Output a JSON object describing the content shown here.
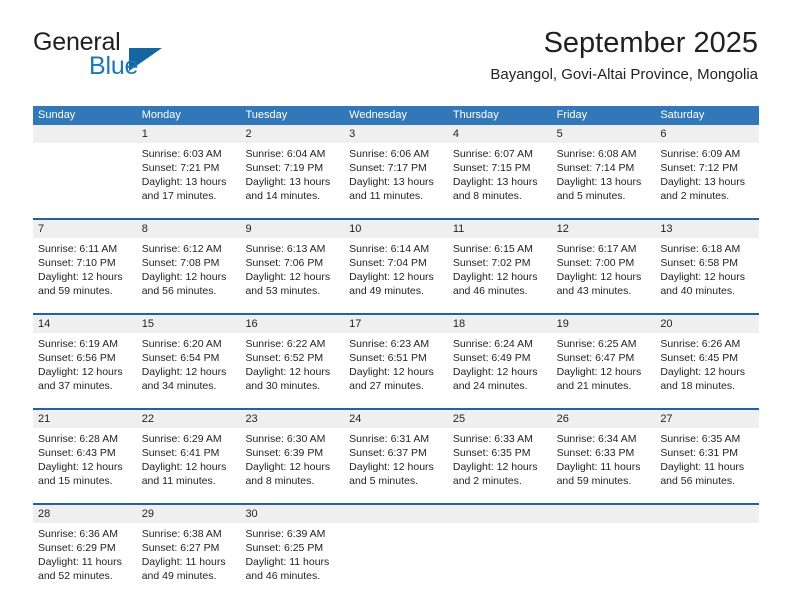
{
  "brand": {
    "name_part1": "General",
    "name_part2": "Blue"
  },
  "header": {
    "title": "September 2025",
    "subtitle": "Bayangol, Govi-Altai Province, Mongolia"
  },
  "colors": {
    "header_blue": "#3278b8",
    "row_border_blue": "#1f63a5",
    "day_band_gray": "#efefef",
    "brand_blue": "#1b77bd",
    "text": "#231f20"
  },
  "weekdays": [
    "Sunday",
    "Monday",
    "Tuesday",
    "Wednesday",
    "Thursday",
    "Friday",
    "Saturday"
  ],
  "weeks": [
    [
      {
        "day": "",
        "empty": true,
        "sunrise": "",
        "sunset": "",
        "daylight_line1": "",
        "daylight_line2": ""
      },
      {
        "day": "1",
        "empty": false,
        "sunrise": "Sunrise: 6:03 AM",
        "sunset": "Sunset: 7:21 PM",
        "daylight_line1": "Daylight: 13 hours",
        "daylight_line2": "and 17 minutes."
      },
      {
        "day": "2",
        "empty": false,
        "sunrise": "Sunrise: 6:04 AM",
        "sunset": "Sunset: 7:19 PM",
        "daylight_line1": "Daylight: 13 hours",
        "daylight_line2": "and 14 minutes."
      },
      {
        "day": "3",
        "empty": false,
        "sunrise": "Sunrise: 6:06 AM",
        "sunset": "Sunset: 7:17 PM",
        "daylight_line1": "Daylight: 13 hours",
        "daylight_line2": "and 11 minutes."
      },
      {
        "day": "4",
        "empty": false,
        "sunrise": "Sunrise: 6:07 AM",
        "sunset": "Sunset: 7:15 PM",
        "daylight_line1": "Daylight: 13 hours",
        "daylight_line2": "and 8 minutes."
      },
      {
        "day": "5",
        "empty": false,
        "sunrise": "Sunrise: 6:08 AM",
        "sunset": "Sunset: 7:14 PM",
        "daylight_line1": "Daylight: 13 hours",
        "daylight_line2": "and 5 minutes."
      },
      {
        "day": "6",
        "empty": false,
        "sunrise": "Sunrise: 6:09 AM",
        "sunset": "Sunset: 7:12 PM",
        "daylight_line1": "Daylight: 13 hours",
        "daylight_line2": "and 2 minutes."
      }
    ],
    [
      {
        "day": "7",
        "empty": false,
        "sunrise": "Sunrise: 6:11 AM",
        "sunset": "Sunset: 7:10 PM",
        "daylight_line1": "Daylight: 12 hours",
        "daylight_line2": "and 59 minutes."
      },
      {
        "day": "8",
        "empty": false,
        "sunrise": "Sunrise: 6:12 AM",
        "sunset": "Sunset: 7:08 PM",
        "daylight_line1": "Daylight: 12 hours",
        "daylight_line2": "and 56 minutes."
      },
      {
        "day": "9",
        "empty": false,
        "sunrise": "Sunrise: 6:13 AM",
        "sunset": "Sunset: 7:06 PM",
        "daylight_line1": "Daylight: 12 hours",
        "daylight_line2": "and 53 minutes."
      },
      {
        "day": "10",
        "empty": false,
        "sunrise": "Sunrise: 6:14 AM",
        "sunset": "Sunset: 7:04 PM",
        "daylight_line1": "Daylight: 12 hours",
        "daylight_line2": "and 49 minutes."
      },
      {
        "day": "11",
        "empty": false,
        "sunrise": "Sunrise: 6:15 AM",
        "sunset": "Sunset: 7:02 PM",
        "daylight_line1": "Daylight: 12 hours",
        "daylight_line2": "and 46 minutes."
      },
      {
        "day": "12",
        "empty": false,
        "sunrise": "Sunrise: 6:17 AM",
        "sunset": "Sunset: 7:00 PM",
        "daylight_line1": "Daylight: 12 hours",
        "daylight_line2": "and 43 minutes."
      },
      {
        "day": "13",
        "empty": false,
        "sunrise": "Sunrise: 6:18 AM",
        "sunset": "Sunset: 6:58 PM",
        "daylight_line1": "Daylight: 12 hours",
        "daylight_line2": "and 40 minutes."
      }
    ],
    [
      {
        "day": "14",
        "empty": false,
        "sunrise": "Sunrise: 6:19 AM",
        "sunset": "Sunset: 6:56 PM",
        "daylight_line1": "Daylight: 12 hours",
        "daylight_line2": "and 37 minutes."
      },
      {
        "day": "15",
        "empty": false,
        "sunrise": "Sunrise: 6:20 AM",
        "sunset": "Sunset: 6:54 PM",
        "daylight_line1": "Daylight: 12 hours",
        "daylight_line2": "and 34 minutes."
      },
      {
        "day": "16",
        "empty": false,
        "sunrise": "Sunrise: 6:22 AM",
        "sunset": "Sunset: 6:52 PM",
        "daylight_line1": "Daylight: 12 hours",
        "daylight_line2": "and 30 minutes."
      },
      {
        "day": "17",
        "empty": false,
        "sunrise": "Sunrise: 6:23 AM",
        "sunset": "Sunset: 6:51 PM",
        "daylight_line1": "Daylight: 12 hours",
        "daylight_line2": "and 27 minutes."
      },
      {
        "day": "18",
        "empty": false,
        "sunrise": "Sunrise: 6:24 AM",
        "sunset": "Sunset: 6:49 PM",
        "daylight_line1": "Daylight: 12 hours",
        "daylight_line2": "and 24 minutes."
      },
      {
        "day": "19",
        "empty": false,
        "sunrise": "Sunrise: 6:25 AM",
        "sunset": "Sunset: 6:47 PM",
        "daylight_line1": "Daylight: 12 hours",
        "daylight_line2": "and 21 minutes."
      },
      {
        "day": "20",
        "empty": false,
        "sunrise": "Sunrise: 6:26 AM",
        "sunset": "Sunset: 6:45 PM",
        "daylight_line1": "Daylight: 12 hours",
        "daylight_line2": "and 18 minutes."
      }
    ],
    [
      {
        "day": "21",
        "empty": false,
        "sunrise": "Sunrise: 6:28 AM",
        "sunset": "Sunset: 6:43 PM",
        "daylight_line1": "Daylight: 12 hours",
        "daylight_line2": "and 15 minutes."
      },
      {
        "day": "22",
        "empty": false,
        "sunrise": "Sunrise: 6:29 AM",
        "sunset": "Sunset: 6:41 PM",
        "daylight_line1": "Daylight: 12 hours",
        "daylight_line2": "and 11 minutes."
      },
      {
        "day": "23",
        "empty": false,
        "sunrise": "Sunrise: 6:30 AM",
        "sunset": "Sunset: 6:39 PM",
        "daylight_line1": "Daylight: 12 hours",
        "daylight_line2": "and 8 minutes."
      },
      {
        "day": "24",
        "empty": false,
        "sunrise": "Sunrise: 6:31 AM",
        "sunset": "Sunset: 6:37 PM",
        "daylight_line1": "Daylight: 12 hours",
        "daylight_line2": "and 5 minutes."
      },
      {
        "day": "25",
        "empty": false,
        "sunrise": "Sunrise: 6:33 AM",
        "sunset": "Sunset: 6:35 PM",
        "daylight_line1": "Daylight: 12 hours",
        "daylight_line2": "and 2 minutes."
      },
      {
        "day": "26",
        "empty": false,
        "sunrise": "Sunrise: 6:34 AM",
        "sunset": "Sunset: 6:33 PM",
        "daylight_line1": "Daylight: 11 hours",
        "daylight_line2": "and 59 minutes."
      },
      {
        "day": "27",
        "empty": false,
        "sunrise": "Sunrise: 6:35 AM",
        "sunset": "Sunset: 6:31 PM",
        "daylight_line1": "Daylight: 11 hours",
        "daylight_line2": "and 56 minutes."
      }
    ],
    [
      {
        "day": "28",
        "empty": false,
        "sunrise": "Sunrise: 6:36 AM",
        "sunset": "Sunset: 6:29 PM",
        "daylight_line1": "Daylight: 11 hours",
        "daylight_line2": "and 52 minutes."
      },
      {
        "day": "29",
        "empty": false,
        "sunrise": "Sunrise: 6:38 AM",
        "sunset": "Sunset: 6:27 PM",
        "daylight_line1": "Daylight: 11 hours",
        "daylight_line2": "and 49 minutes."
      },
      {
        "day": "30",
        "empty": false,
        "sunrise": "Sunrise: 6:39 AM",
        "sunset": "Sunset: 6:25 PM",
        "daylight_line1": "Daylight: 11 hours",
        "daylight_line2": "and 46 minutes."
      },
      {
        "day": "",
        "empty": true,
        "sunrise": "",
        "sunset": "",
        "daylight_line1": "",
        "daylight_line2": ""
      },
      {
        "day": "",
        "empty": true,
        "sunrise": "",
        "sunset": "",
        "daylight_line1": "",
        "daylight_line2": ""
      },
      {
        "day": "",
        "empty": true,
        "sunrise": "",
        "sunset": "",
        "daylight_line1": "",
        "daylight_line2": ""
      },
      {
        "day": "",
        "empty": true,
        "sunrise": "",
        "sunset": "",
        "daylight_line1": "",
        "daylight_line2": ""
      }
    ]
  ]
}
